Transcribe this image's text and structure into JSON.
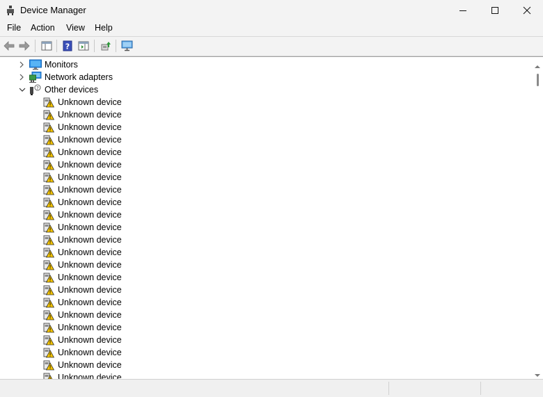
{
  "window": {
    "title": "Device Manager"
  },
  "menu": {
    "items": [
      {
        "label": "File"
      },
      {
        "label": "Action"
      },
      {
        "label": "View"
      },
      {
        "label": "Help"
      }
    ]
  },
  "toolbar": {
    "buttons": [
      {
        "icon": "back-arrow-icon"
      },
      {
        "icon": "forward-arrow-icon"
      },
      {
        "icon": "show-hide-console-tree-icon"
      },
      {
        "icon": "help-icon"
      },
      {
        "icon": "show-action-pane-icon"
      },
      {
        "icon": "update-driver-icon"
      },
      {
        "icon": "scan-hardware-changes-icon"
      }
    ]
  },
  "tree": {
    "categories": [
      {
        "label": "Monitors",
        "expanded": false,
        "icon": "monitor-icon"
      },
      {
        "label": "Network adapters",
        "expanded": false,
        "icon": "network-adapter-icon"
      },
      {
        "label": "Other devices",
        "expanded": true,
        "icon": "other-devices-icon"
      }
    ],
    "devices": [
      {
        "label": "Unknown device"
      },
      {
        "label": "Unknown device"
      },
      {
        "label": "Unknown device"
      },
      {
        "label": "Unknown device"
      },
      {
        "label": "Unknown device"
      },
      {
        "label": "Unknown device"
      },
      {
        "label": "Unknown device"
      },
      {
        "label": "Unknown device"
      },
      {
        "label": "Unknown device"
      },
      {
        "label": "Unknown device"
      },
      {
        "label": "Unknown device"
      },
      {
        "label": "Unknown device"
      },
      {
        "label": "Unknown device"
      },
      {
        "label": "Unknown device"
      },
      {
        "label": "Unknown device"
      },
      {
        "label": "Unknown device"
      },
      {
        "label": "Unknown device"
      },
      {
        "label": "Unknown device"
      },
      {
        "label": "Unknown device"
      },
      {
        "label": "Unknown device"
      },
      {
        "label": "Unknown device"
      },
      {
        "label": "Unknown device"
      },
      {
        "label": "Unknown device"
      },
      {
        "label": "Unknown device"
      }
    ]
  },
  "colors": {
    "warning": "#f5c400",
    "accent": "#1e73d8"
  }
}
